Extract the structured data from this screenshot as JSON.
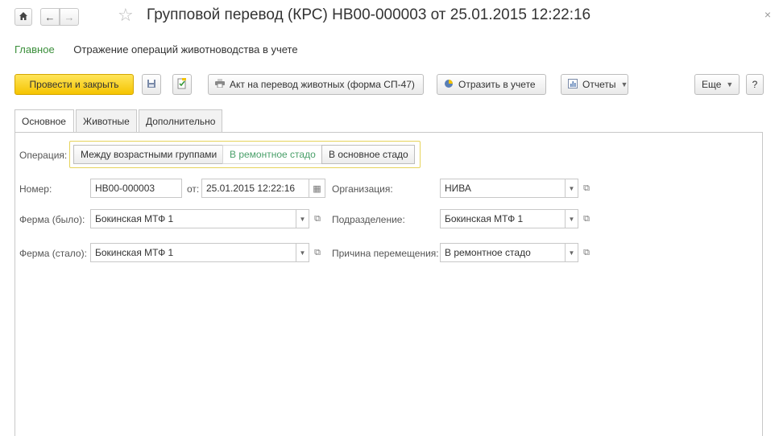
{
  "header": {
    "title": "Групповой перевод (КРС) НВ00-000003 от 25.01.2015 12:22:16",
    "home_icon": "home-icon",
    "back_icon": "arrow-left-icon",
    "forward_icon": "arrow-right-icon",
    "star_icon": "star-icon",
    "close_label": "×"
  },
  "nav": {
    "main_link": "Главное",
    "section_link": "Отражение операций животноводства в учете"
  },
  "toolbar": {
    "post_close_label": "Провести и закрыть",
    "print_act_label": "Акт на перевод животных (форма СП-47)",
    "reflect_label": "Отразить в учете",
    "reports_label": "Отчеты",
    "more_label": "Еще",
    "help_label": "?"
  },
  "tabs": [
    "Основное",
    "Животные",
    "Дополнительно"
  ],
  "operation": {
    "label": "Операция:",
    "options": [
      "Между возрастными группами",
      "В ремонтное стадо",
      "В основное стадо"
    ],
    "selected": "В ремонтное стадо"
  },
  "form": {
    "number_label": "Номер:",
    "number_value": "НВ00-000003",
    "date_label": "от:",
    "date_value": "25.01.2015 12:22:16",
    "org_label": "Организация:",
    "org_value": "НИВА",
    "farm_was_label": "Ферма (было):",
    "farm_was_value": "Бокинская МТФ 1",
    "division_label": "Подразделение:",
    "division_value": "Бокинская МТФ 1",
    "farm_now_label": "Ферма (стало):",
    "farm_now_value": "Бокинская МТФ 1",
    "reason_label": "Причина перемещения:",
    "reason_value": "В ремонтное стадо"
  },
  "colors": {
    "primary_button": "#f5c400",
    "nav_green": "#3b8f3b",
    "selected_option": "#4aa06a",
    "group_border": "#e6d35a"
  }
}
